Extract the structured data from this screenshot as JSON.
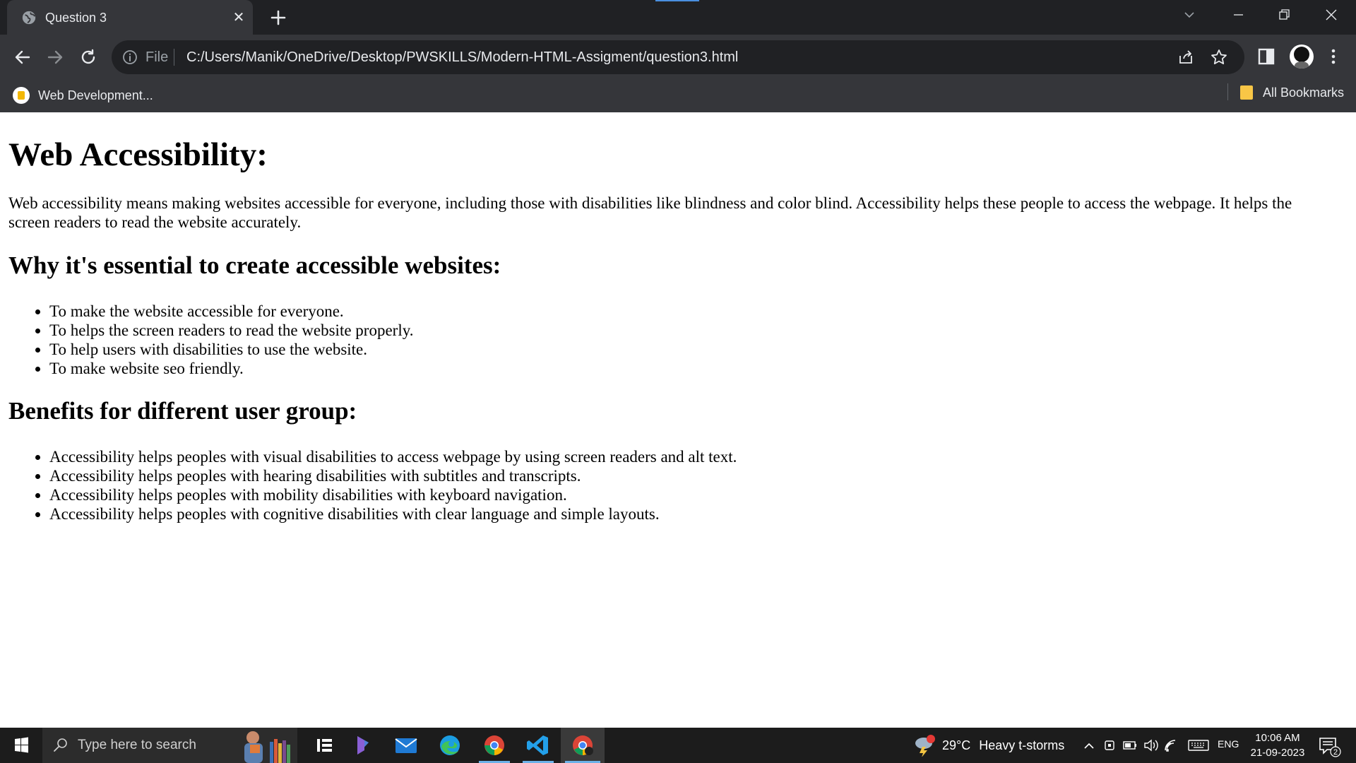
{
  "browser": {
    "tab_title": "Question 3",
    "tab_close": "✕",
    "url_scheme": "File",
    "url": "C:/Users/Manik/OneDrive/Desktop/PWSKILLS/Modern-HTML-Assigment/question3.html",
    "bookmark_label": "Web Development...",
    "all_bookmarks": "All Bookmarks"
  },
  "page": {
    "heading": "Web Accessibility:",
    "intro": "Web accessibility means making websites accessible for everyone, including those with disabilities like blindness and color blind. Accessibility helps these people to access the webpage. It helps the screen readers to read the website accurately.",
    "section1_title": "Why it's essential to create accessible websites:",
    "section1_items": [
      "To make the website accessible for everyone.",
      "To helps the screen readers to read the website properly.",
      "To help users with disabilities to use the website.",
      "To make website seo friendly."
    ],
    "section2_title": "Benefits for different user group:",
    "section2_items": [
      "Accessibility helps peoples with visual disabilities to access webpage by using screen readers and alt text.",
      "Accessibility helps peoples with hearing disabilities with subtitles and transcripts.",
      "Accessibility helps peoples with mobility disabilities with keyboard navigation.",
      "Accessibility helps peoples with cognitive disabilities with clear language and simple layouts."
    ]
  },
  "taskbar": {
    "search_placeholder": "Type here to search",
    "weather_temp": "29°C",
    "weather_condition": "Heavy t-storms",
    "language": "ENG",
    "time": "10:06 AM",
    "date": "21-09-2023",
    "notification_count": "2",
    "pinned_apps": [
      "task-view",
      "copilot",
      "mail",
      "edge",
      "chrome",
      "vscode",
      "chrome-profile"
    ]
  },
  "colors": {
    "tabstrip": "#202124",
    "toolbar": "#35363a",
    "taskbar": "#1c1c1c",
    "accent": "#6cb1e8"
  }
}
